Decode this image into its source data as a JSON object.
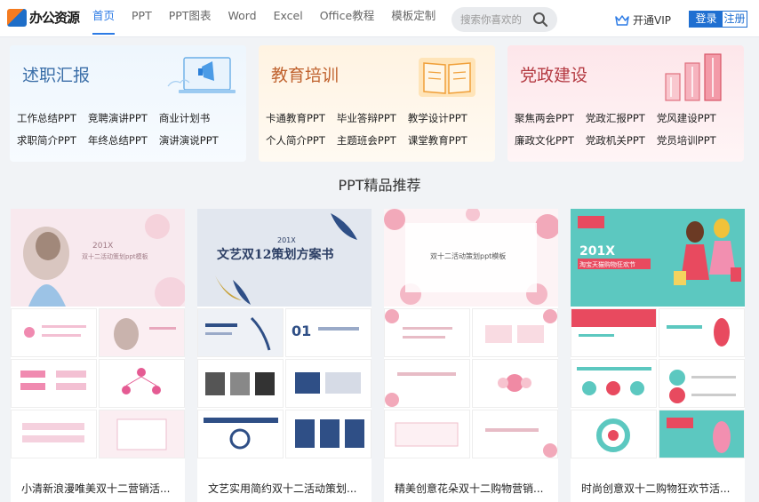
{
  "header": {
    "logo_text": "办公资源",
    "nav": [
      {
        "label": "首页",
        "active": true
      },
      {
        "label": "PPT"
      },
      {
        "label": "PPT图表"
      },
      {
        "label": "Word"
      },
      {
        "label": "Excel"
      },
      {
        "label": "Office教程"
      },
      {
        "label": "模板定制"
      }
    ],
    "search_placeholder": "搜索你喜欢的",
    "vip_label": "开通VIP",
    "login_label": "登录",
    "register_label": "注册"
  },
  "categories": [
    {
      "title": "述职汇报",
      "links": [
        "工作总结PPT",
        "竞聘演讲PPT",
        "商业计划书",
        "求职简介PPT",
        "年终总结PPT",
        "演讲演说PPT"
      ]
    },
    {
      "title": "教育培训",
      "links": [
        "卡通教育PPT",
        "毕业答辩PPT",
        "教学设计PPT",
        "个人简介PPT",
        "主题班会PPT",
        "课堂教育PPT"
      ]
    },
    {
      "title": "党政建设",
      "links": [
        "聚焦两会PPT",
        "党政汇报PPT",
        "党风建设PPT",
        "廉政文化PPT",
        "党政机关PPT",
        "党员培训PPT"
      ]
    }
  ],
  "section_title": "PPT精品推荐",
  "templates": [
    {
      "title": "小清新浪漫唯美双十二营销活...",
      "cover_year": "201X",
      "cover_title": "双十二活动策划ppt模板"
    },
    {
      "title": "文艺实用简约双十二活动策划...",
      "cover_year": "201X",
      "cover_title": "文艺双12策划方案书"
    },
    {
      "title": "精美创意花朵双十二购物营销...",
      "cover_year": "",
      "cover_title": "双十二活动策划ppt模板"
    },
    {
      "title": "时尚创意双十二购物狂欢节活...",
      "cover_year": "201X",
      "cover_title": "淘宝天猫购物狂欢节"
    }
  ],
  "colors": {
    "accent": "#2d7be5",
    "login_bg": "#1f6fd1"
  }
}
